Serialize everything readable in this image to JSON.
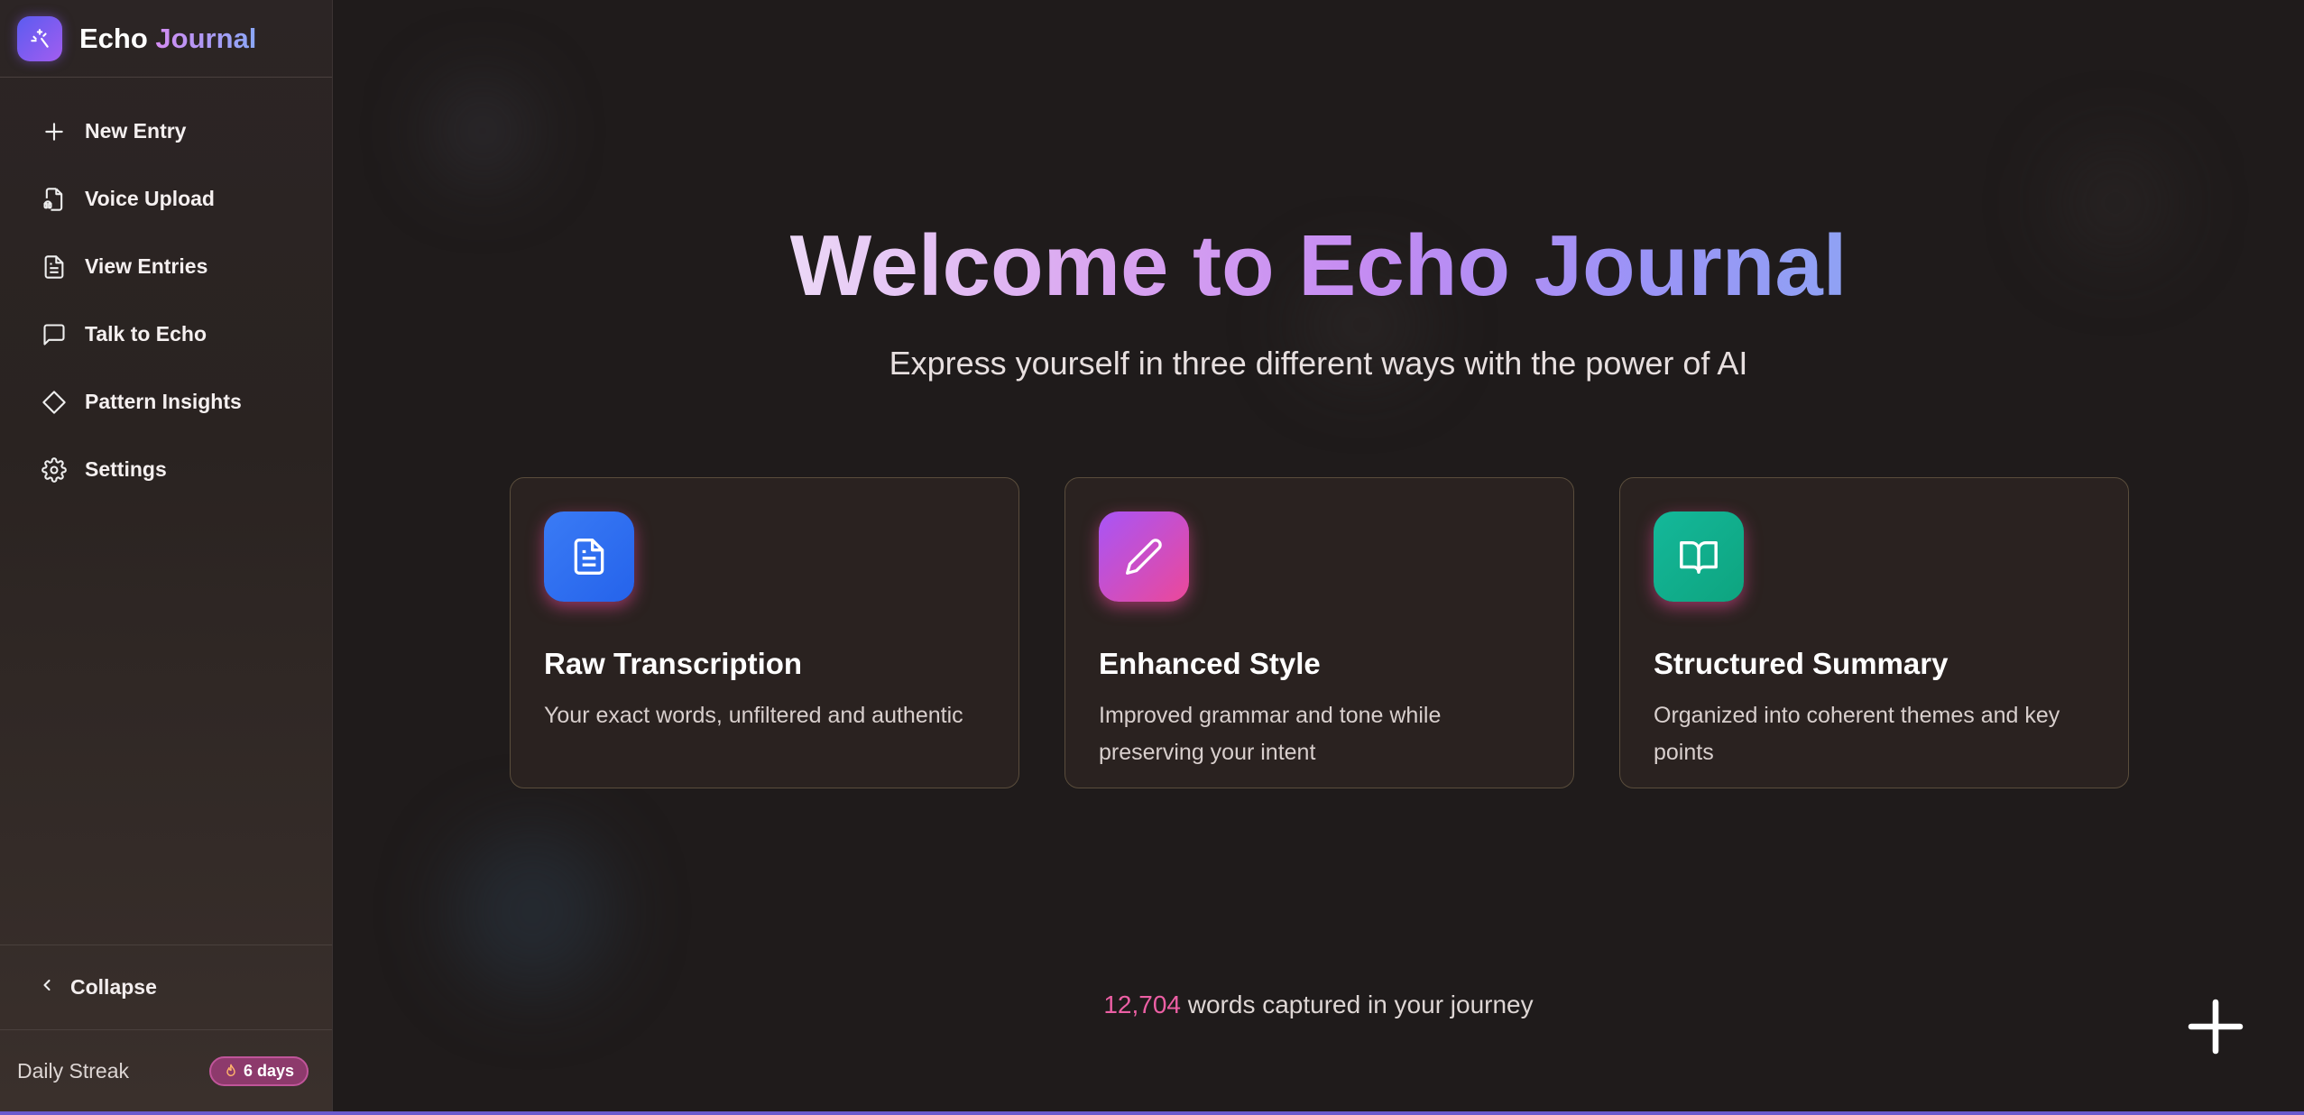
{
  "brand": {
    "name_part1": "Echo",
    "name_part2": "Journal"
  },
  "sidebar": {
    "items": [
      {
        "label": "New Entry",
        "icon": "plus-icon"
      },
      {
        "label": "Voice Upload",
        "icon": "audio-file-icon"
      },
      {
        "label": "View Entries",
        "icon": "document-icon"
      },
      {
        "label": "Talk to Echo",
        "icon": "chat-icon"
      },
      {
        "label": "Pattern Insights",
        "icon": "diamond-icon"
      },
      {
        "label": "Settings",
        "icon": "gear-icon"
      }
    ],
    "collapse_label": "Collapse",
    "streak_label": "Daily Streak",
    "streak_value": "6 days"
  },
  "hero": {
    "title": "Welcome to Echo Journal",
    "subtitle": "Express yourself in three different ways with the power of AI"
  },
  "cards": [
    {
      "title": "Raw Transcription",
      "description": "Your exact words, unfiltered and authentic",
      "icon": "document-icon",
      "color": "#3b82f6"
    },
    {
      "title": "Enhanced Style",
      "description": "Improved grammar and tone while preserving your intent",
      "icon": "pencil-icon",
      "color": "#c04fd8"
    },
    {
      "title": "Structured Summary",
      "description": "Organized into coherent themes and key points",
      "icon": "book-open-icon",
      "color": "#10b98a"
    }
  ],
  "footer": {
    "word_count": "12,704",
    "word_count_suffix": " words captured in your journey"
  },
  "colors": {
    "accent_pink": "#ec5fa4",
    "background": "#1f1b1b",
    "sidebar": "#2c2525"
  }
}
